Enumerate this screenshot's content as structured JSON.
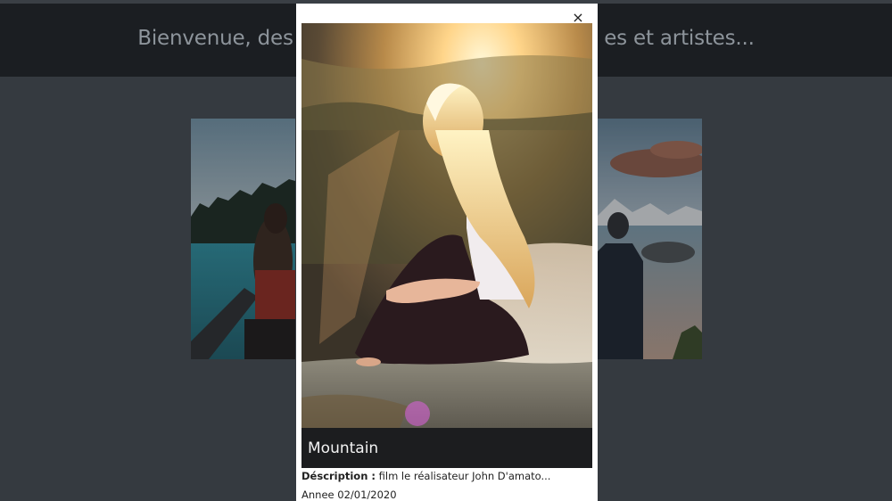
{
  "header": {
    "title": "Bienvenue, des                                                 es et artistes..."
  },
  "modal": {
    "close_label": "×",
    "title": "Mountain",
    "description_label": "Déscription :",
    "description_text": " film le réalisateur John D'amato...",
    "year_label": "Annee",
    "year_value": "02/01/2020"
  }
}
